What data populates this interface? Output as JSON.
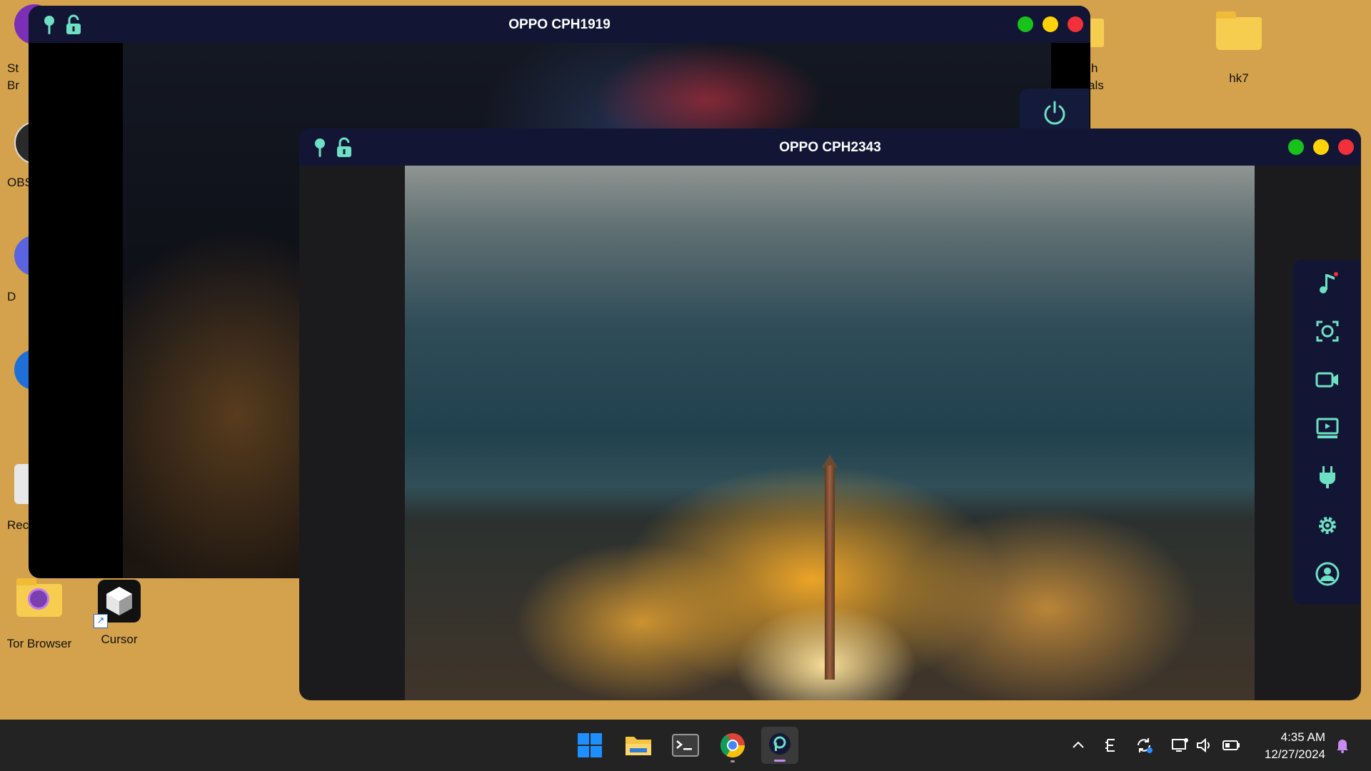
{
  "desktop": {
    "icons": [
      {
        "label": "hk7",
        "kind": "folder"
      },
      {
        "label": "Tor Browser",
        "kind": "app"
      },
      {
        "label": "Cursor",
        "kind": "app"
      }
    ],
    "partial_left_labels": [
      "St",
      "Br",
      "OBS",
      "D",
      "Rec"
    ],
    "partial_right_labels": [
      "h",
      "als"
    ]
  },
  "windows": [
    {
      "title": "OPPO CPH1919",
      "left_icons": [
        "map-pin-icon",
        "unlock-icon"
      ],
      "power_icon": "power-icon"
    },
    {
      "title": "OPPO CPH2343",
      "left_icons": [
        "map-pin-icon",
        "unlock-icon"
      ]
    }
  ],
  "sidebar": {
    "items": [
      {
        "icon": "music-note-icon"
      },
      {
        "icon": "screenshot-icon"
      },
      {
        "icon": "video-record-icon"
      },
      {
        "icon": "screen-cast-icon"
      },
      {
        "icon": "plug-icon"
      },
      {
        "icon": "settings-gear-icon"
      },
      {
        "icon": "account-icon"
      }
    ]
  },
  "taskbar": {
    "apps": [
      "windows-start-icon",
      "file-explorer-icon",
      "terminal-icon",
      "chrome-icon",
      "phone-mirror-app-icon"
    ],
    "tray": [
      "chevron-up-icon",
      "input-indicator-icon",
      "sync-icon",
      "network-icon",
      "volume-icon",
      "battery-icon"
    ],
    "time": "4:35 AM",
    "date": "12/27/2024",
    "notification_icon": "bell-icon"
  },
  "colors": {
    "desktop_bg": "#d4a24c",
    "window_titlebar": "#121634",
    "accent_icon": "#6ee0c4",
    "dot_green": "#17c21b",
    "dot_yellow": "#ffd20a",
    "dot_red": "#f1303b"
  }
}
